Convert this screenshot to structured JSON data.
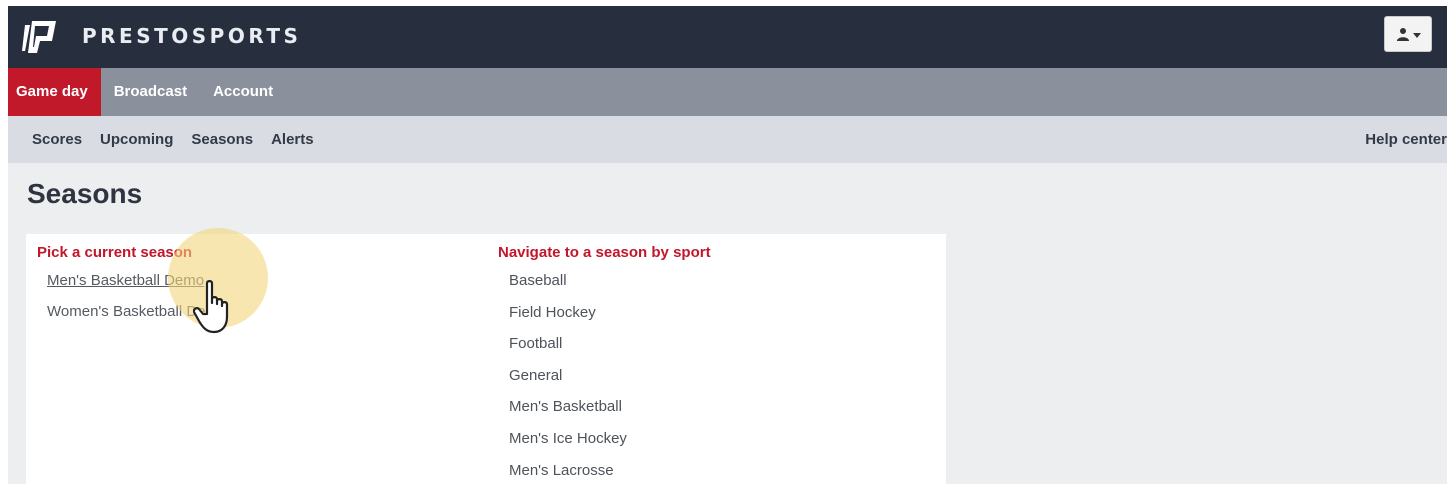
{
  "header": {
    "brand": "PRESTOSPORTS",
    "user_menu_icon": "user-icon"
  },
  "primary_nav": [
    {
      "label": "Game day",
      "active": true
    },
    {
      "label": "Broadcast",
      "active": false
    },
    {
      "label": "Account",
      "active": false
    }
  ],
  "secondary_nav": {
    "items": [
      {
        "label": "Scores"
      },
      {
        "label": "Upcoming"
      },
      {
        "label": "Seasons"
      },
      {
        "label": "Alerts"
      }
    ],
    "help_label": "Help center"
  },
  "page": {
    "title": "Seasons"
  },
  "current_seasons": {
    "heading": "Pick a current season",
    "items": [
      {
        "label": "Men's Basketball Demo"
      },
      {
        "label": "Women's Basketball Demo"
      }
    ]
  },
  "sports": {
    "heading": "Navigate to a season by sport",
    "items": [
      {
        "label": "Baseball"
      },
      {
        "label": "Field Hockey"
      },
      {
        "label": "Football"
      },
      {
        "label": "General"
      },
      {
        "label": "Men's Basketball"
      },
      {
        "label": "Men's Ice Hockey"
      },
      {
        "label": "Men's Lacrosse"
      }
    ]
  },
  "colors": {
    "header_bg": "#272f3f",
    "primary_nav_bg": "#8b919c",
    "active_tab": "#c1182a",
    "secondary_nav_bg": "#d9dde3",
    "heading_red": "#c4162b",
    "cursor_highlight": "#f1d67a"
  }
}
